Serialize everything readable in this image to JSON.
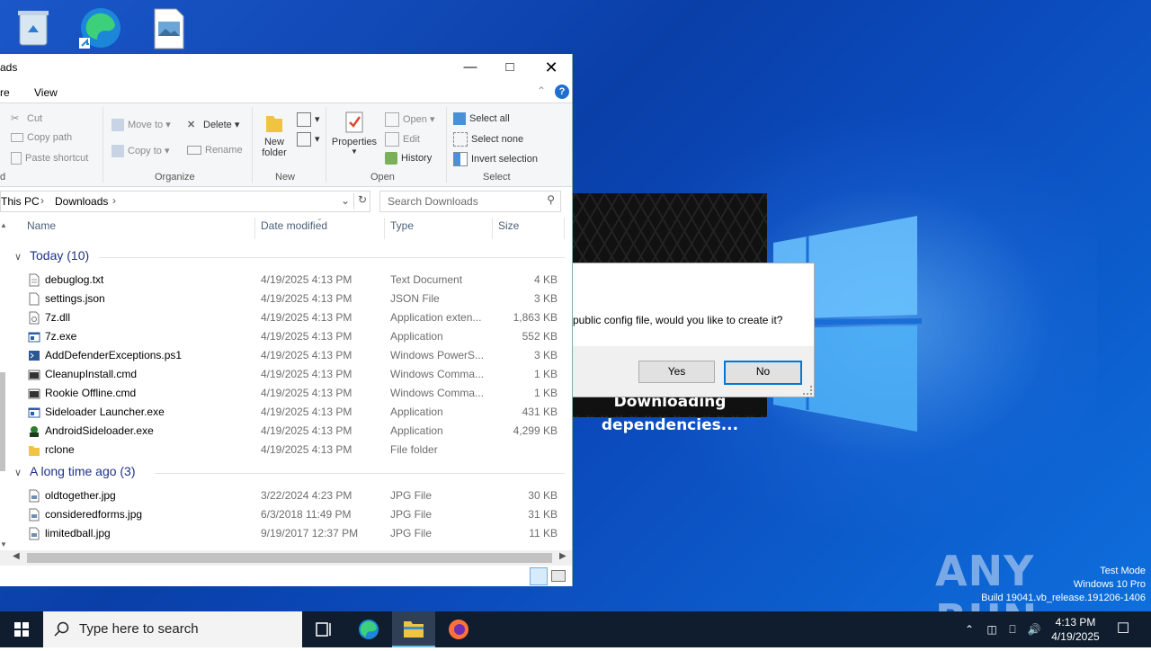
{
  "desktop": {
    "icons": [
      "recycle-bin-icon",
      "edge-shortcut-icon",
      "image-file-icon"
    ],
    "watermark": {
      "line1": "Test Mode",
      "line2": "Windows 10 Pro",
      "line3": "Build 19041.vb_release.191206-1406"
    },
    "anyrun": "ANY RUN"
  },
  "loader": {
    "status": "Downloading dependencies..."
  },
  "dialog": {
    "message": "public config file, would you like to create it?",
    "yes": "Yes",
    "no": "No"
  },
  "explorer": {
    "title": "ads",
    "menu": {
      "share": "re",
      "view": "View"
    },
    "ribbon": {
      "cut": "Cut",
      "copy_path": "Copy path",
      "paste_shortcut": "Paste shortcut",
      "move_to": "Move to",
      "copy_to": "Copy to",
      "delete": "Delete",
      "rename": "Rename",
      "new_folder_1": "New",
      "new_folder_2": "folder",
      "properties": "Properties",
      "open": "Open",
      "edit": "Edit",
      "history": "History",
      "select_all": "Select all",
      "select_none": "Select none",
      "invert_selection": "Invert selection",
      "groups": {
        "clipboard": "d",
        "organize": "Organize",
        "new": "New",
        "open": "Open",
        "select": "Select"
      }
    },
    "address": {
      "this_pc": "This PC",
      "downloads": "Downloads"
    },
    "search_placeholder": "Search Downloads",
    "columns": {
      "name": "Name",
      "date": "Date modified",
      "type": "Type",
      "size": "Size"
    },
    "groups": [
      {
        "title": "Today (10)",
        "files": [
          {
            "name": "debuglog.txt",
            "date": "4/19/2025 4:13 PM",
            "type": "Text Document",
            "size": "4 KB",
            "icon": "text-file-icon"
          },
          {
            "name": "settings.json",
            "date": "4/19/2025 4:13 PM",
            "type": "JSON File",
            "size": "3 KB",
            "icon": "file-icon"
          },
          {
            "name": "7z.dll",
            "date": "4/19/2025 4:13 PM",
            "type": "Application exten...",
            "size": "1,863 KB",
            "icon": "dll-file-icon"
          },
          {
            "name": "7z.exe",
            "date": "4/19/2025 4:13 PM",
            "type": "Application",
            "size": "552 KB",
            "icon": "exe-icon"
          },
          {
            "name": "AddDefenderExceptions.ps1",
            "date": "4/19/2025 4:13 PM",
            "type": "Windows PowerS...",
            "size": "3 KB",
            "icon": "powershell-icon"
          },
          {
            "name": "CleanupInstall.cmd",
            "date": "4/19/2025 4:13 PM",
            "type": "Windows Comma...",
            "size": "1 KB",
            "icon": "cmd-file-icon"
          },
          {
            "name": "Rookie Offline.cmd",
            "date": "4/19/2025 4:13 PM",
            "type": "Windows Comma...",
            "size": "1 KB",
            "icon": "cmd-file-icon"
          },
          {
            "name": "Sideloader Launcher.exe",
            "date": "4/19/2025 4:13 PM",
            "type": "Application",
            "size": "431 KB",
            "icon": "exe-icon"
          },
          {
            "name": "AndroidSideloader.exe",
            "date": "4/19/2025 4:13 PM",
            "type": "Application",
            "size": "4,299 KB",
            "icon": "android-app-icon"
          },
          {
            "name": "rclone",
            "date": "4/19/2025 4:13 PM",
            "type": "File folder",
            "size": "",
            "icon": "folder-icon"
          }
        ]
      },
      {
        "title": "A long time ago (3)",
        "files": [
          {
            "name": "oldtogether.jpg",
            "date": "3/22/2024 4:23 PM",
            "type": "JPG File",
            "size": "30 KB",
            "icon": "image-file-icon"
          },
          {
            "name": "consideredforms.jpg",
            "date": "6/3/2018 11:49 PM",
            "type": "JPG File",
            "size": "31 KB",
            "icon": "image-file-icon"
          },
          {
            "name": "limitedball.jpg",
            "date": "9/19/2017 12:37 PM",
            "type": "JPG File",
            "size": "11 KB",
            "icon": "image-file-icon"
          }
        ]
      }
    ]
  },
  "taskbar": {
    "search_placeholder": "Type here to search",
    "time": "4:13 PM",
    "date": "4/19/2025"
  }
}
